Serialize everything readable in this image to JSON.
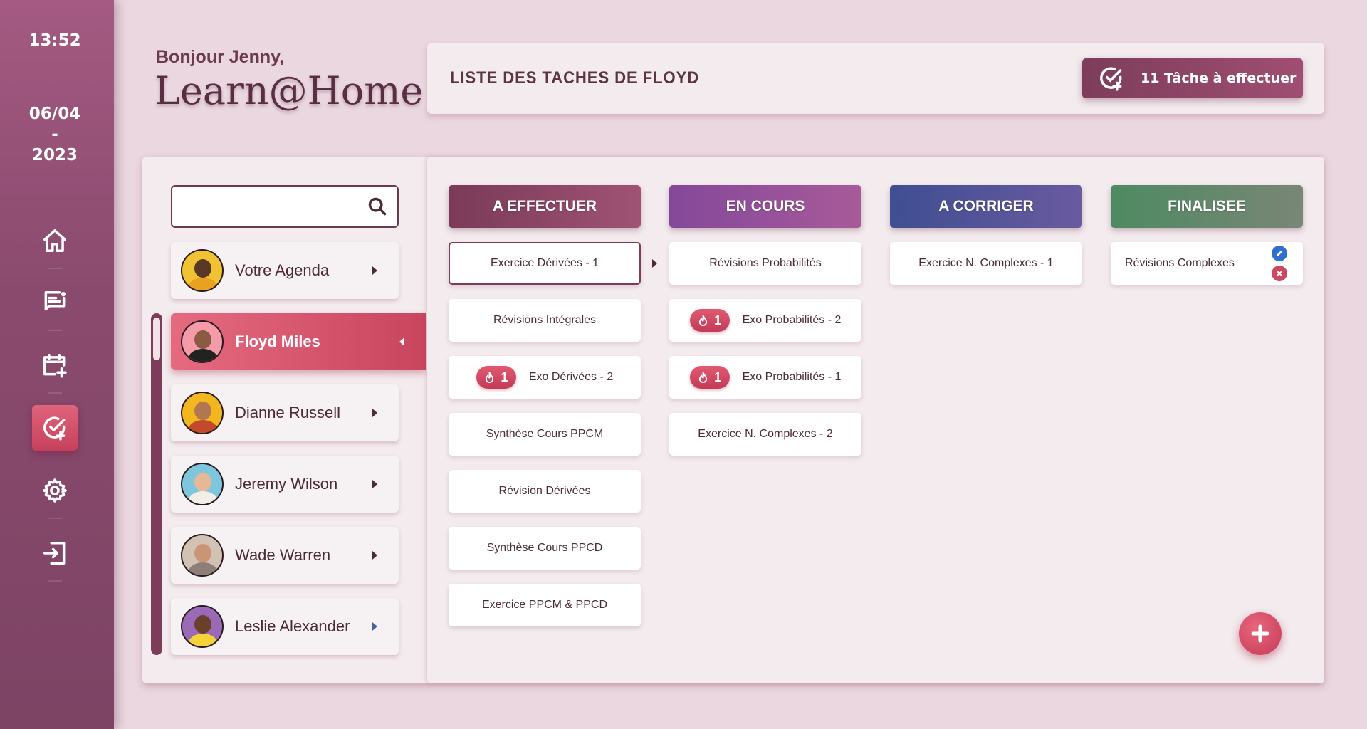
{
  "sidebar": {
    "time": "13:52",
    "date": "06/04\n-\n2023",
    "nav": [
      {
        "name": "home-icon",
        "active": false
      },
      {
        "name": "messages-icon",
        "active": false
      },
      {
        "name": "calendar-add-icon",
        "active": false
      },
      {
        "name": "tasks-icon",
        "active": true
      },
      {
        "name": "settings-icon",
        "active": false
      },
      {
        "name": "logout-icon",
        "active": false
      }
    ]
  },
  "header": {
    "greeting": "Bonjour Jenny,",
    "brand": "Learn@Home",
    "list_title": "LISTE DES TACHES DE FLOYD",
    "task_button": "11 Tâche à effectuer"
  },
  "search": {
    "value": "",
    "placeholder": ""
  },
  "people": [
    {
      "name": "Votre Agenda",
      "active": false
    },
    {
      "name": "Floyd Miles",
      "active": true
    },
    {
      "name": "Dianne Russell",
      "active": false
    },
    {
      "name": "Jeremy Wilson",
      "active": false
    },
    {
      "name": "Wade Warren",
      "active": false
    },
    {
      "name": "Leslie Alexander",
      "active": false
    }
  ],
  "columns": [
    {
      "title": "A EFFECTUER",
      "color": "#8a4263",
      "cards": [
        {
          "label": "Exercice Dérivées - 1",
          "badge": null,
          "selected": true
        },
        {
          "label": "Révisions Intégrales",
          "badge": null
        },
        {
          "label": "Exo Dérivées - 2",
          "badge": "1"
        },
        {
          "label": "Synthèse Cours PPCM",
          "badge": null
        },
        {
          "label": "Révision Dérivées",
          "badge": null
        },
        {
          "label": "Synthèse Cours PPCD",
          "badge": null
        },
        {
          "label": "Exercice PPCM & PPCD",
          "badge": null
        }
      ]
    },
    {
      "title": "EN COURS",
      "color": "#8f4f94",
      "cards": [
        {
          "label": "Révisions Probabilités",
          "badge": null
        },
        {
          "label": "Exo Probabilités - 2",
          "badge": "1"
        },
        {
          "label": "Exo Probabilités - 1",
          "badge": "1"
        },
        {
          "label": "Exercice N. Complexes - 2",
          "badge": null
        }
      ]
    },
    {
      "title": "A CORRIGER",
      "color": "#4d4f94",
      "cards": [
        {
          "label": "Exercice N. Complexes - 1",
          "badge": null
        }
      ]
    },
    {
      "title": "FINALISEE",
      "color": "#5a8a6c",
      "cards": [
        {
          "label": "Révisions Complexes",
          "badge": null
        }
      ]
    }
  ],
  "colors": {
    "accent": "#c9455e",
    "primary": "#7d3d5a",
    "edit": "#2f6fd0",
    "delete": "#d0465c"
  }
}
